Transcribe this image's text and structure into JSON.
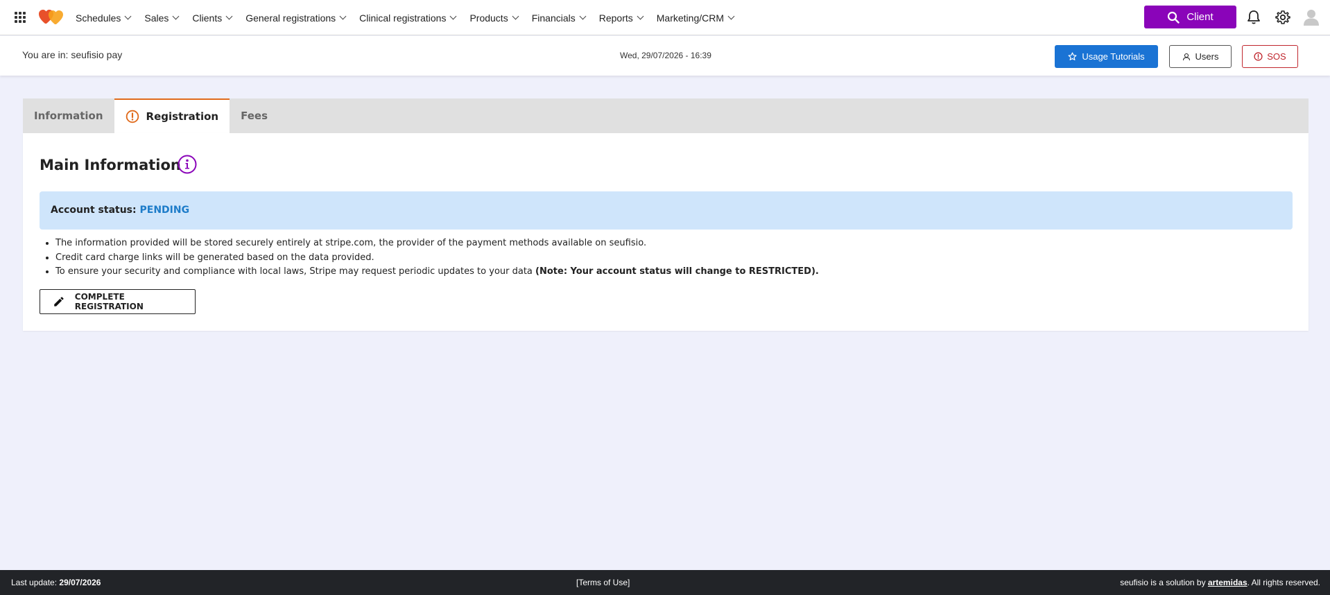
{
  "nav": {
    "menu": [
      {
        "label": "Schedules"
      },
      {
        "label": "Sales"
      },
      {
        "label": "Clients"
      },
      {
        "label": "General registrations"
      },
      {
        "label": "Clinical registrations"
      },
      {
        "label": "Products"
      },
      {
        "label": "Financials"
      },
      {
        "label": "Reports"
      },
      {
        "label": "Marketing/CRM"
      }
    ],
    "client_button": "Client",
    "accent_color": "#8a04b9"
  },
  "location": {
    "text": "You are in: seufisio pay",
    "datetime": "Wed, 29/07/2026 - 16:39",
    "tutorials_label": "Usage Tutorials",
    "users_label": "Users",
    "sos_label": "SOS"
  },
  "tabs": [
    {
      "label": "Information",
      "active": false
    },
    {
      "label": "Registration",
      "active": true
    },
    {
      "label": "Fees",
      "active": false
    }
  ],
  "main": {
    "title": "Main Information",
    "status_label": "Account status:",
    "status_value": "PENDING",
    "bullets": [
      "The information provided will be stored securely entirely at stripe.com, the provider of the payment methods available on seufisio.",
      "Credit card charge links will be generated based on the data provided."
    ],
    "bullet3_text": "To ensure your security and compliance with local laws, Stripe may request periodic updates to your data ",
    "bullet3_bold": "(Note: Your account status will change to RESTRICTED).",
    "complete_button": "COMPLETE REGISTRATION"
  },
  "footer": {
    "last_update_label": "Last update: ",
    "last_update_date": "29/07/2026",
    "terms": "[Terms of Use]",
    "credit_prefix": "seufisio is a solution by ",
    "credit_link": "artemidas",
    "credit_suffix": ". All rights reserved."
  }
}
